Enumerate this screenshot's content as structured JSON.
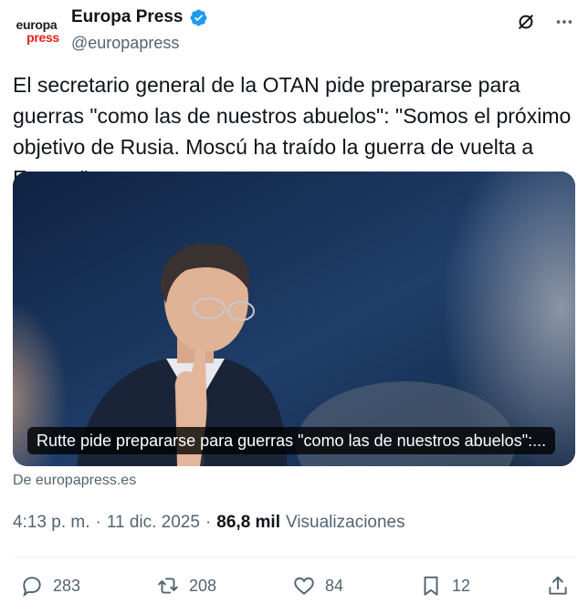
{
  "author": {
    "avatar_line1": "europa",
    "avatar_line2": "press",
    "display_name": "Europa Press",
    "handle": "@europapress"
  },
  "header": {
    "grok_icon": "slashed-circle-icon",
    "more_icon": "more-dots-icon"
  },
  "tweet": {
    "text": "El secretario general de la OTAN pide prepararse para guerras \"como las de nuestros abuelos\": \"Somos el próximo objetivo de Rusia. Moscú ha traído la guerra de vuelta a Europa\""
  },
  "card": {
    "title": "Rutte pide prepararse para guerras \"como las de nuestros abuelos\":...",
    "source": "De europapress.es"
  },
  "meta": {
    "time": "4:13 p. m.",
    "sep1": "·",
    "date": "11 dic. 2025",
    "sep2": "·",
    "views_count": "86,8 mil",
    "views_label": "Visualizaciones"
  },
  "actions": {
    "replies": "283",
    "reposts": "208",
    "likes": "84",
    "bookmarks": "12"
  },
  "colors": {
    "verified": "#1d9bf0",
    "secondary_text": "#536471",
    "brand_red": "#e2231a"
  }
}
